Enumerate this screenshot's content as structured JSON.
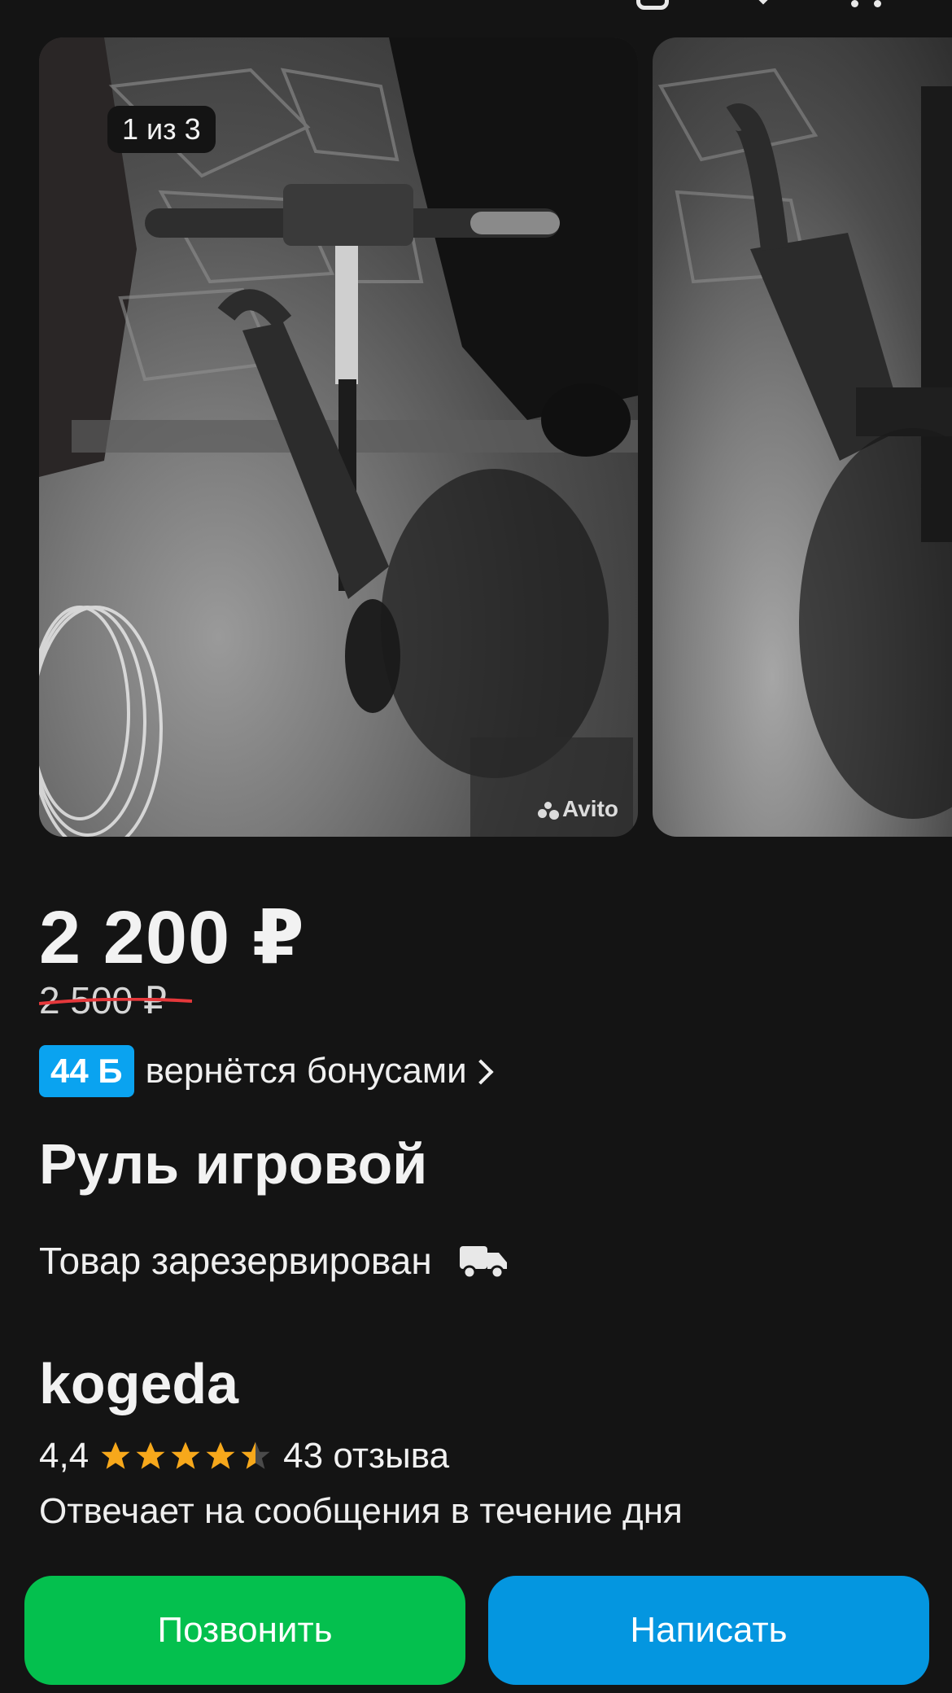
{
  "header": {
    "back_icon": "arrow-left-icon",
    "share_icon": "share-icon",
    "favorite_icon": "heart-icon",
    "more_icon": "more-dots-icon"
  },
  "gallery": {
    "counter": "1 из 3",
    "watermark": "Avito",
    "current_index": 1,
    "total": 3
  },
  "listing": {
    "price": "2 200 ₽",
    "old_price": "2 500 ₽",
    "bonus_badge": "44 Б",
    "bonus_text": "вернётся бонусами",
    "title": "Руль игровой",
    "status": "Товар зарезервирован",
    "delivery_icon": "truck-icon"
  },
  "seller": {
    "name": "kogeda",
    "rating": "4,4",
    "rating_value": 4.4,
    "reviews": "43 отзыва",
    "response_time": "Отвечает на сообщения в течение дня"
  },
  "actions": {
    "call_label": "Позвонить",
    "write_label": "Написать"
  },
  "colors": {
    "background": "#141414",
    "call_button": "#04c04e",
    "write_button": "#0496e0",
    "bonus_badge": "#0aa3f0",
    "star": "#f7a81b",
    "strike": "#e5383b"
  }
}
